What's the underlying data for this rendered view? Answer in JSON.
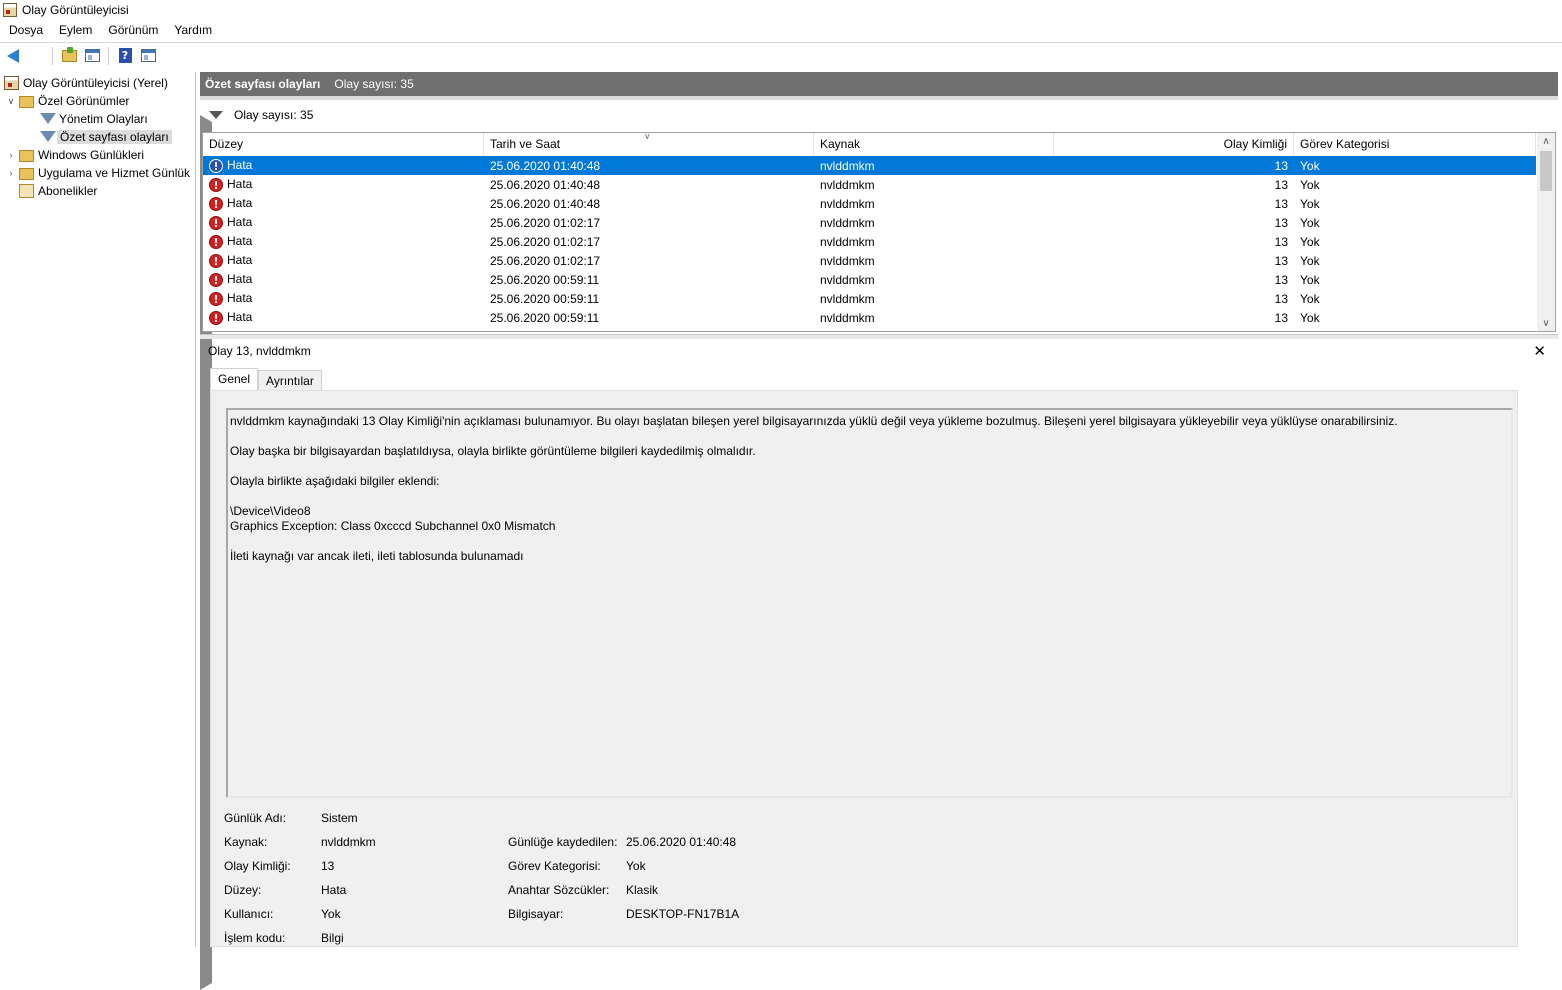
{
  "window": {
    "title": "Olay Görüntüleyicisi"
  },
  "menu": [
    "Dosya",
    "Eylem",
    "Görünüm",
    "Yardım"
  ],
  "tree": {
    "root": "Olay Görüntüleyicisi (Yerel)",
    "custom_views": "Özel Görünümler",
    "admin_events": "Yönetim Olayları",
    "summary_events": "Özet sayfası olayları",
    "windows_logs": "Windows Günlükleri",
    "app_service_logs": "Uygulama ve Hizmet Günlük",
    "subscriptions": "Abonelikler"
  },
  "header": {
    "title": "Özet sayfası olayları",
    "count": "Olay sayısı: 35"
  },
  "filter": {
    "text": "Olay sayısı: 35"
  },
  "grid": {
    "columns": [
      "Düzey",
      "Tarih ve Saat",
      "Kaynak",
      "Olay Kimliği",
      "Görev Kategorisi"
    ],
    "rows": [
      [
        "Hata",
        "25.06.2020 01:40:48",
        "nvlddmkm",
        "13",
        "Yok"
      ],
      [
        "Hata",
        "25.06.2020 01:40:48",
        "nvlddmkm",
        "13",
        "Yok"
      ],
      [
        "Hata",
        "25.06.2020 01:40:48",
        "nvlddmkm",
        "13",
        "Yok"
      ],
      [
        "Hata",
        "25.06.2020 01:02:17",
        "nvlddmkm",
        "13",
        "Yok"
      ],
      [
        "Hata",
        "25.06.2020 01:02:17",
        "nvlddmkm",
        "13",
        "Yok"
      ],
      [
        "Hata",
        "25.06.2020 01:02:17",
        "nvlddmkm",
        "13",
        "Yok"
      ],
      [
        "Hata",
        "25.06.2020 00:59:11",
        "nvlddmkm",
        "13",
        "Yok"
      ],
      [
        "Hata",
        "25.06.2020 00:59:11",
        "nvlddmkm",
        "13",
        "Yok"
      ],
      [
        "Hata",
        "25.06.2020 00:59:11",
        "nvlddmkm",
        "13",
        "Yok"
      ]
    ]
  },
  "detail": {
    "title": "Olay 13, nvlddmkm",
    "tabs": [
      "Genel",
      "Ayrıntılar"
    ],
    "description": [
      "nvlddmkm kaynağındaki 13 Olay Kimliği'nin açıklaması bulunamıyor. Bu olayı başlatan bileşen yerel bilgisayarınızda yüklü değil veya yükleme bozulmuş. Bileşeni yerel bilgisayara yükleyebilir veya yüklüyse onarabilirsiniz.",
      "Olay başka bir bilgisayardan başlatıldıysa, olayla birlikte görüntüleme bilgileri kaydedilmiş olmalıdır.",
      "Olayla birlikte aşağıdaki bilgiler eklendi:",
      "\\Device\\Video8\nGraphics Exception: Class 0xcccd Subchannel 0x0 Mismatch",
      "İleti kaynağı var ancak ileti, ileti tablosunda bulunamadı"
    ],
    "props": {
      "log_name_label": "Günlük Adı:",
      "log_name": "Sistem",
      "source_label": "Kaynak:",
      "source": "nvlddmkm",
      "logged_label": "Günlüğe kaydedilen:",
      "logged": "25.06.2020 01:40:48",
      "event_id_label": "Olay Kimliği:",
      "event_id": "13",
      "task_label": "Görev Kategorisi:",
      "task": "Yok",
      "level_label": "Düzey:",
      "level": "Hata",
      "keywords_label": "Anahtar Sözcükler:",
      "keywords": "Klasik",
      "user_label": "Kullanıcı:",
      "user": "Yok",
      "computer_label": "Bilgisayar:",
      "computer": "DESKTOP-FN17B1A",
      "opcode_label": "İşlem kodu:",
      "opcode": "Bilgi"
    }
  }
}
